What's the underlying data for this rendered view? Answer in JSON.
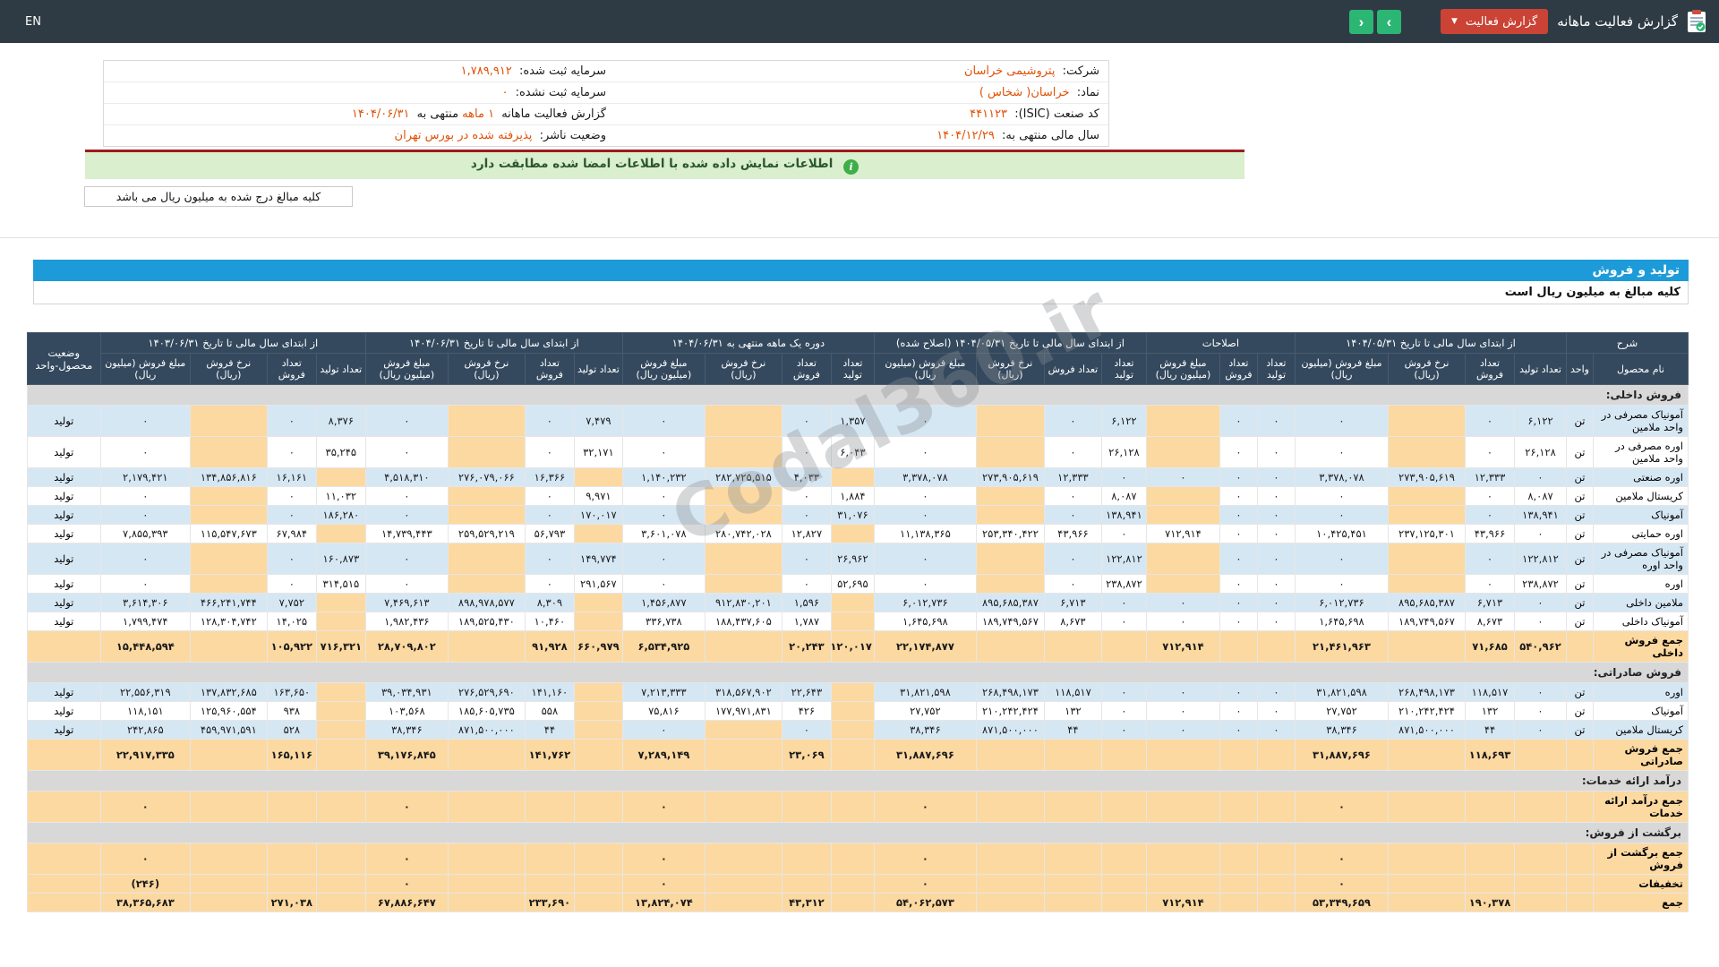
{
  "topbar": {
    "title": "گزارش فعالیت ماهانه",
    "report_button_label": "گزارش فعالیت",
    "language_label": "EN",
    "icons": {
      "caret_down": "▼",
      "chevron_right": "›",
      "chevron_left": "‹",
      "info": "i"
    }
  },
  "info": {
    "right_column": [
      {
        "label": "شرکت:",
        "value": "پتروشیمی خراسان"
      },
      {
        "label": "نماد:",
        "value": "خراسان( شخاس )"
      },
      {
        "label": "کد صنعت (ISIC):",
        "value": "۴۴۱۱۲۳"
      },
      {
        "label": "سال مالی منتهی به:",
        "value": "۱۴۰۴/۱۲/۲۹"
      }
    ],
    "left_column": [
      {
        "label": "سرمایه ثبت شده:",
        "value": "۱,۷۸۹,۹۱۲"
      },
      {
        "label": "سرمایه ثبت نشده:",
        "value": "۰"
      },
      {
        "label": "گزارش فعالیت ماهانه",
        "value": "۱ ماهه",
        "label2": "منتهی به",
        "value2": "۱۴۰۴/۰۶/۳۱"
      },
      {
        "label": "وضعیت ناشر:",
        "value": "پذیرفته شده در بورس تهران"
      }
    ]
  },
  "banner": {
    "text": "اطلاعات نمایش داده شده با اطلاعات امضا شده مطابقت دارد"
  },
  "note": {
    "text": "کلیه مبالغ درج شده به میلیون ریال می باشد"
  },
  "section_bar": {
    "title": "تولید و فروش"
  },
  "units_note": {
    "text": "کلیه مبالغ به میلیون ریال است"
  },
  "watermark": "Codal360.ir",
  "table": {
    "col_groups": [
      {
        "label": "شرح",
        "cols": [
          "نام محصول",
          "واحد"
        ]
      },
      {
        "label": "از ابتدای سال مالی تا تاریخ ۱۴۰۴/۰۵/۳۱",
        "cols": [
          "تعداد تولید",
          "تعداد فروش",
          "نرخ فروش (ریال)",
          "مبلغ فروش (میلیون ریال)"
        ]
      },
      {
        "label": "اصلاحات",
        "cols": [
          "تعداد تولید",
          "تعداد فروش",
          "مبلغ فروش (میلیون ریال)"
        ]
      },
      {
        "label": "از ابتدای سال مالی تا تاریخ ۱۴۰۴/۰۵/۳۱ (اصلاح شده)",
        "cols": [
          "تعداد تولید",
          "تعداد فروش",
          "نرخ فروش (ریال)",
          "مبلغ فروش (میلیون ریال)"
        ]
      },
      {
        "label": "دوره یک ماهه منتهی به ۱۴۰۴/۰۶/۳۱",
        "cols": [
          "تعداد تولید",
          "تعداد فروش",
          "نرخ فروش (ریال)",
          "مبلغ فروش (میلیون ریال)"
        ]
      },
      {
        "label": "از ابتدای سال مالی تا تاریخ ۱۴۰۴/۰۶/۳۱",
        "cols": [
          "تعداد تولید",
          "تعداد فروش",
          "نرخ فروش (ریال)",
          "مبلغ فروش (میلیون ریال)"
        ]
      },
      {
        "label": "از ابتدای سال مالی تا تاریخ ۱۴۰۳/۰۶/۳۱",
        "cols": [
          "تعداد تولید",
          "تعداد فروش",
          "نرخ فروش (ریال)",
          "مبلغ فروش (میلیون ریال)"
        ]
      },
      {
        "label": "وضعیت محصول-واحد",
        "cols": []
      }
    ],
    "rows": [
      {
        "type": "section",
        "label": "فروش داخلی:"
      },
      {
        "type": "product",
        "name": "آمونیاک مصرفی در واحد ملامین",
        "unit": "تن",
        "status": "تولید",
        "cells": [
          "۶,۱۲۲",
          "۰",
          "",
          "۰",
          "۰",
          "۰",
          "",
          "۶,۱۲۲",
          "۰",
          "",
          "۰",
          "۱,۳۵۷",
          "۰",
          "",
          "۰",
          "۷,۴۷۹",
          "۰",
          "",
          "۰",
          "۸,۳۷۶",
          "۰",
          "",
          "۰"
        ]
      },
      {
        "type": "product",
        "name": "اوره مصرفی در واحد ملامین",
        "unit": "تن",
        "status": "تولید",
        "cells": [
          "۲۶,۱۲۸",
          "۰",
          "",
          "۰",
          "۰",
          "۰",
          "",
          "۲۶,۱۲۸",
          "۰",
          "",
          "۰",
          "۶,۰۴۳",
          "۰",
          "",
          "۰",
          "۳۲,۱۷۱",
          "۰",
          "",
          "۰",
          "۳۵,۲۴۵",
          "۰",
          "",
          "۰"
        ]
      },
      {
        "type": "product",
        "name": "اوره صنعتی",
        "unit": "تن",
        "status": "تولید",
        "cells": [
          "۰",
          "۱۲,۳۳۳",
          "۲۷۳,۹۰۵,۶۱۹",
          "۳,۳۷۸,۰۷۸",
          "۰",
          "۰",
          "۰",
          "۰",
          "۱۲,۳۳۳",
          "۲۷۳,۹۰۵,۶۱۹",
          "۳,۳۷۸,۰۷۸",
          "",
          "۴,۰۳۳",
          "۲۸۲,۷۲۵,۵۱۵",
          "۱,۱۴۰,۲۳۲",
          "",
          "۱۶,۳۶۶",
          "۲۷۶,۰۷۹,۰۶۶",
          "۴,۵۱۸,۳۱۰",
          "",
          "۱۶,۱۶۱",
          "۱۳۴,۸۵۶,۸۱۶",
          "۲,۱۷۹,۴۲۱"
        ]
      },
      {
        "type": "product",
        "name": "کریستال ملامین",
        "unit": "تن",
        "status": "تولید",
        "cells": [
          "۸,۰۸۷",
          "۰",
          "",
          "۰",
          "۰",
          "۰",
          "",
          "۸,۰۸۷",
          "۰",
          "",
          "۰",
          "۱,۸۸۴",
          "۰",
          "",
          "۰",
          "۹,۹۷۱",
          "۰",
          "",
          "۰",
          "۱۱,۰۳۲",
          "۰",
          "",
          "۰"
        ]
      },
      {
        "type": "product",
        "name": "آمونیاک",
        "unit": "تن",
        "status": "تولید",
        "cells": [
          "۱۳۸,۹۴۱",
          "۰",
          "",
          "۰",
          "۰",
          "۰",
          "",
          "۱۳۸,۹۴۱",
          "۰",
          "",
          "۰",
          "۳۱,۰۷۶",
          "۰",
          "",
          "۰",
          "۱۷۰,۰۱۷",
          "۰",
          "",
          "۰",
          "۱۸۶,۲۸۰",
          "۰",
          "",
          "۰"
        ]
      },
      {
        "type": "product",
        "name": "اوره حمایتی",
        "unit": "تن",
        "status": "تولید",
        "cells": [
          "۰",
          "۴۳,۹۶۶",
          "۲۳۷,۱۲۵,۳۰۱",
          "۱۰,۴۲۵,۴۵۱",
          "۰",
          "۰",
          "۷۱۲,۹۱۴",
          "۰",
          "۴۳,۹۶۶",
          "۲۵۳,۳۴۰,۴۲۲",
          "۱۱,۱۳۸,۳۶۵",
          "",
          "۱۲,۸۲۷",
          "۲۸۰,۷۴۲,۰۲۸",
          "۳,۶۰۱,۰۷۸",
          "",
          "۵۶,۷۹۳",
          "۲۵۹,۵۲۹,۲۱۹",
          "۱۴,۷۳۹,۴۴۳",
          "",
          "۶۷,۹۸۴",
          "۱۱۵,۵۴۷,۶۷۳",
          "۷,۸۵۵,۳۹۳"
        ]
      },
      {
        "type": "product",
        "name": "آمونیاک مصرفی در واحد اوره",
        "unit": "تن",
        "status": "تولید",
        "cells": [
          "۱۲۲,۸۱۲",
          "۰",
          "",
          "۰",
          "۰",
          "۰",
          "",
          "۱۲۲,۸۱۲",
          "۰",
          "",
          "۰",
          "۲۶,۹۶۲",
          "۰",
          "",
          "۰",
          "۱۴۹,۷۷۴",
          "۰",
          "",
          "۰",
          "۱۶۰,۸۷۳",
          "۰",
          "",
          "۰"
        ]
      },
      {
        "type": "product",
        "name": "اوره",
        "unit": "تن",
        "status": "تولید",
        "cells": [
          "۲۳۸,۸۷۲",
          "۰",
          "",
          "۰",
          "۰",
          "۰",
          "",
          "۲۳۸,۸۷۲",
          "۰",
          "",
          "۰",
          "۵۲,۶۹۵",
          "۰",
          "",
          "۰",
          "۲۹۱,۵۶۷",
          "۰",
          "",
          "۰",
          "۳۱۴,۵۱۵",
          "۰",
          "",
          "۰"
        ]
      },
      {
        "type": "product",
        "name": "ملامین داخلی",
        "unit": "تن",
        "status": "تولید",
        "cells": [
          "۰",
          "۶,۷۱۳",
          "۸۹۵,۶۸۵,۳۸۷",
          "۶,۰۱۲,۷۳۶",
          "۰",
          "۰",
          "۰",
          "۰",
          "۶,۷۱۳",
          "۸۹۵,۶۸۵,۳۸۷",
          "۶,۰۱۲,۷۳۶",
          "",
          "۱,۵۹۶",
          "۹۱۲,۸۳۰,۲۰۱",
          "۱,۴۵۶,۸۷۷",
          "",
          "۸,۳۰۹",
          "۸۹۸,۹۷۸,۵۷۷",
          "۷,۴۶۹,۶۱۳",
          "",
          "۷,۷۵۲",
          "۴۶۶,۲۴۱,۷۴۴",
          "۳,۶۱۴,۳۰۶"
        ]
      },
      {
        "type": "product",
        "name": "آمونیاک داخلی",
        "unit": "تن",
        "status": "تولید",
        "cells": [
          "۰",
          "۸,۶۷۳",
          "۱۸۹,۷۴۹,۵۶۷",
          "۱,۶۴۵,۶۹۸",
          "۰",
          "۰",
          "۰",
          "۰",
          "۸,۶۷۳",
          "۱۸۹,۷۴۹,۵۶۷",
          "۱,۶۴۵,۶۹۸",
          "",
          "۱,۷۸۷",
          "۱۸۸,۴۳۷,۶۰۵",
          "۳۳۶,۷۳۸",
          "",
          "۱۰,۴۶۰",
          "۱۸۹,۵۲۵,۴۳۰",
          "۱,۹۸۲,۴۳۶",
          "",
          "۱۴,۰۲۵",
          "۱۲۸,۳۰۴,۷۴۲",
          "۱,۷۹۹,۴۷۴"
        ]
      },
      {
        "type": "total",
        "name": "جمع فروش داخلی",
        "unit": "",
        "status": "",
        "cells": [
          "۵۴۰,۹۶۲",
          "۷۱,۶۸۵",
          "",
          "۲۱,۴۶۱,۹۶۳",
          "",
          "",
          "۷۱۲,۹۱۴",
          "",
          "",
          "",
          "۲۲,۱۷۴,۸۷۷",
          "۱۲۰,۰۱۷",
          "۲۰,۲۴۳",
          "",
          "۶,۵۳۴,۹۲۵",
          "۶۶۰,۹۷۹",
          "۹۱,۹۲۸",
          "",
          "۲۸,۷۰۹,۸۰۲",
          "۷۱۶,۳۲۱",
          "۱۰۵,۹۲۲",
          "",
          "۱۵,۴۴۸,۵۹۴"
        ]
      },
      {
        "type": "section",
        "label": "فروش صادراتی:"
      },
      {
        "type": "product",
        "name": "اوره",
        "unit": "تن",
        "status": "تولید",
        "cells": [
          "۰",
          "۱۱۸,۵۱۷",
          "۲۶۸,۴۹۸,۱۷۳",
          "۳۱,۸۲۱,۵۹۸",
          "۰",
          "۰",
          "۰",
          "۰",
          "۱۱۸,۵۱۷",
          "۲۶۸,۴۹۸,۱۷۳",
          "۳۱,۸۲۱,۵۹۸",
          "",
          "۲۲,۶۴۳",
          "۳۱۸,۵۶۷,۹۰۲",
          "۷,۲۱۳,۳۳۳",
          "",
          "۱۴۱,۱۶۰",
          "۲۷۶,۵۲۹,۶۹۰",
          "۳۹,۰۳۴,۹۳۱",
          "",
          "۱۶۳,۶۵۰",
          "۱۳۷,۸۳۲,۶۸۵",
          "۲۲,۵۵۶,۳۱۹"
        ]
      },
      {
        "type": "product",
        "name": "آمونیاک",
        "unit": "تن",
        "status": "تولید",
        "cells": [
          "۰",
          "۱۳۲",
          "۲۱۰,۲۴۲,۴۲۴",
          "۲۷,۷۵۲",
          "۰",
          "۰",
          "۰",
          "۰",
          "۱۳۲",
          "۲۱۰,۲۴۲,۴۲۴",
          "۲۷,۷۵۲",
          "",
          "۴۲۶",
          "۱۷۷,۹۷۱,۸۳۱",
          "۷۵,۸۱۶",
          "",
          "۵۵۸",
          "۱۸۵,۶۰۵,۷۳۵",
          "۱۰۳,۵۶۸",
          "",
          "۹۳۸",
          "۱۲۵,۹۶۰,۵۵۴",
          "۱۱۸,۱۵۱"
        ]
      },
      {
        "type": "product",
        "name": "کریستال ملامین",
        "unit": "تن",
        "status": "تولید",
        "cells": [
          "۰",
          "۴۴",
          "۸۷۱,۵۰۰,۰۰۰",
          "۳۸,۳۴۶",
          "۰",
          "۰",
          "۰",
          "۰",
          "۴۴",
          "۸۷۱,۵۰۰,۰۰۰",
          "۳۸,۳۴۶",
          "",
          "۰",
          "",
          "۰",
          "",
          "۴۴",
          "۸۷۱,۵۰۰,۰۰۰",
          "۳۸,۳۴۶",
          "",
          "۵۲۸",
          "۴۵۹,۹۷۱,۵۹۱",
          "۲۴۲,۸۶۵"
        ]
      },
      {
        "type": "total",
        "name": "جمع فروش صادراتی",
        "unit": "",
        "status": "",
        "cells": [
          "",
          "۱۱۸,۶۹۳",
          "",
          "۳۱,۸۸۷,۶۹۶",
          "",
          "",
          "",
          "",
          "",
          "",
          "۳۱,۸۸۷,۶۹۶",
          "",
          "۲۳,۰۶۹",
          "",
          "۷,۲۸۹,۱۴۹",
          "",
          "۱۴۱,۷۶۲",
          "",
          "۳۹,۱۷۶,۸۴۵",
          "",
          "۱۶۵,۱۱۶",
          "",
          "۲۲,۹۱۷,۳۳۵"
        ]
      },
      {
        "type": "section",
        "label": "درآمد ارائه خدمات:"
      },
      {
        "type": "total",
        "name": "جمع درآمد ارائه خدمات",
        "unit": "",
        "status": "",
        "cells": [
          "",
          "",
          "",
          "۰",
          "",
          "",
          "",
          "",
          "",
          "",
          "۰",
          "",
          "",
          "",
          "۰",
          "",
          "",
          "",
          "۰",
          "",
          "",
          "",
          "۰"
        ]
      },
      {
        "type": "section",
        "label": "برگشت از فروش:"
      },
      {
        "type": "total",
        "name": "جمع برگشت از فروش",
        "unit": "",
        "status": "",
        "cells": [
          "",
          "",
          "",
          "۰",
          "",
          "",
          "",
          "",
          "",
          "",
          "۰",
          "",
          "",
          "",
          "۰",
          "",
          "",
          "",
          "۰",
          "",
          "",
          "",
          "۰"
        ]
      },
      {
        "type": "total",
        "name": "تخفیفات",
        "unit": "",
        "status": "",
        "cells": [
          "",
          "",
          "",
          "۰",
          "",
          "",
          "",
          "",
          "",
          "",
          "۰",
          "",
          "",
          "",
          "۰",
          "",
          "",
          "",
          "۰",
          "",
          "",
          "",
          "(۲۴۶)"
        ]
      },
      {
        "type": "total",
        "name": "جمع",
        "unit": "",
        "status": "",
        "cells": [
          "",
          "۱۹۰,۳۷۸",
          "",
          "۵۳,۳۴۹,۶۵۹",
          "",
          "",
          "۷۱۲,۹۱۴",
          "",
          "",
          "",
          "۵۴,۰۶۲,۵۷۳",
          "",
          "۴۳,۳۱۲",
          "",
          "۱۳,۸۲۴,۰۷۴",
          "",
          "۲۳۳,۶۹۰",
          "",
          "۶۷,۸۸۶,۶۴۷",
          "",
          "۲۷۱,۰۳۸",
          "",
          "۳۸,۳۶۵,۶۸۳"
        ]
      }
    ]
  }
}
